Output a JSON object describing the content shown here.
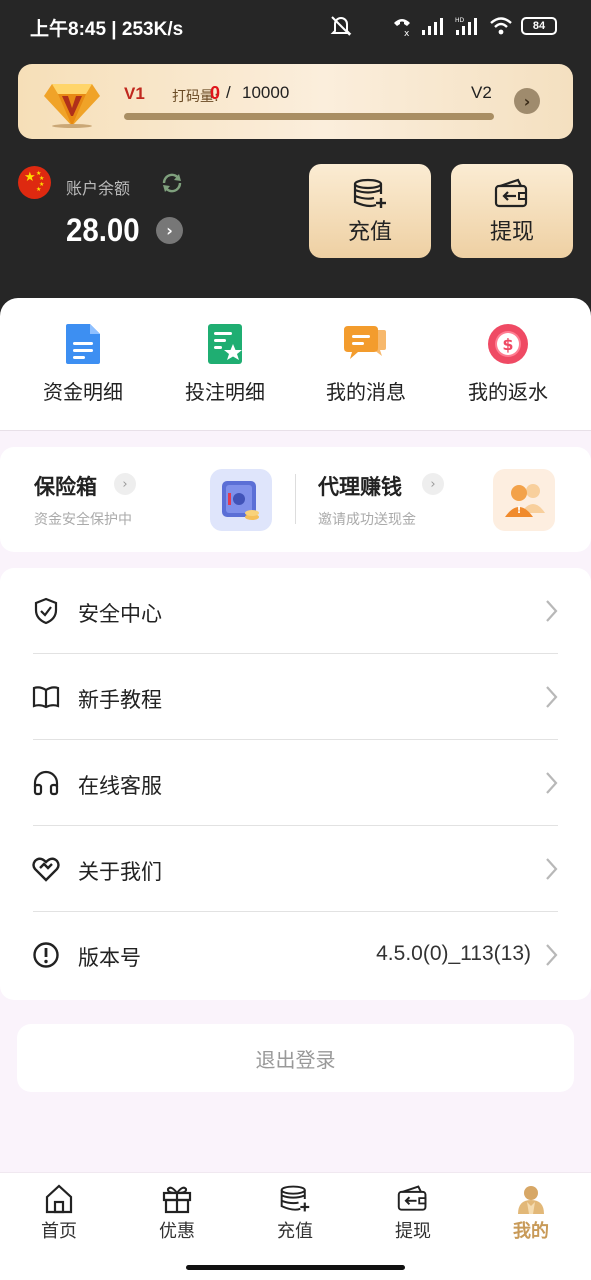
{
  "status_bar": {
    "time_speed": "上午8:45 | 253K/s",
    "battery": "84",
    "icons": [
      "mute-bell-icon",
      "call-icon",
      "signal-icon",
      "hd-signal-icon",
      "wifi-icon",
      "battery-icon"
    ]
  },
  "vip": {
    "current_level": "V1",
    "wager_label": "打码量:",
    "wager_current": "0",
    "separator": "/",
    "wager_target": "10000",
    "progress": 0,
    "next_level": "V2"
  },
  "account": {
    "balance_label": "账户余额",
    "balance": "28.00"
  },
  "actions": {
    "recharge_label": "充值",
    "withdraw_label": "提现"
  },
  "quick_links": [
    {
      "label": "资金明细",
      "icon": "document-icon"
    },
    {
      "label": "投注明细",
      "icon": "bet-list-icon"
    },
    {
      "label": "我的消息",
      "icon": "message-icon"
    },
    {
      "label": "我的返水",
      "icon": "rebate-icon"
    }
  ],
  "cards": {
    "safe": {
      "title": "保险箱",
      "subtitle": "资金安全保护中"
    },
    "agent": {
      "title": "代理赚钱",
      "subtitle": "邀请成功送现金"
    }
  },
  "menu": [
    {
      "label": "安全中心",
      "icon": "shield-icon",
      "value": ""
    },
    {
      "label": "新手教程",
      "icon": "book-icon",
      "value": ""
    },
    {
      "label": "在线客服",
      "icon": "headset-icon",
      "value": ""
    },
    {
      "label": "关于我们",
      "icon": "heart-link-icon",
      "value": ""
    },
    {
      "label": "版本号",
      "icon": "info-icon",
      "value": "4.5.0(0)_113(13)"
    }
  ],
  "logout_label": "退出登录",
  "tabs": [
    {
      "label": "首页",
      "icon": "home-icon",
      "active": false
    },
    {
      "label": "优惠",
      "icon": "gift-icon",
      "active": false
    },
    {
      "label": "充值",
      "icon": "recharge-icon",
      "active": false
    },
    {
      "label": "提现",
      "icon": "wallet-icon",
      "active": false
    },
    {
      "label": "我的",
      "icon": "profile-icon",
      "active": true
    }
  ],
  "colors": {
    "header_bg": "#262626",
    "accent_gold": "#c89a58",
    "vip_red": "#e0141b"
  }
}
